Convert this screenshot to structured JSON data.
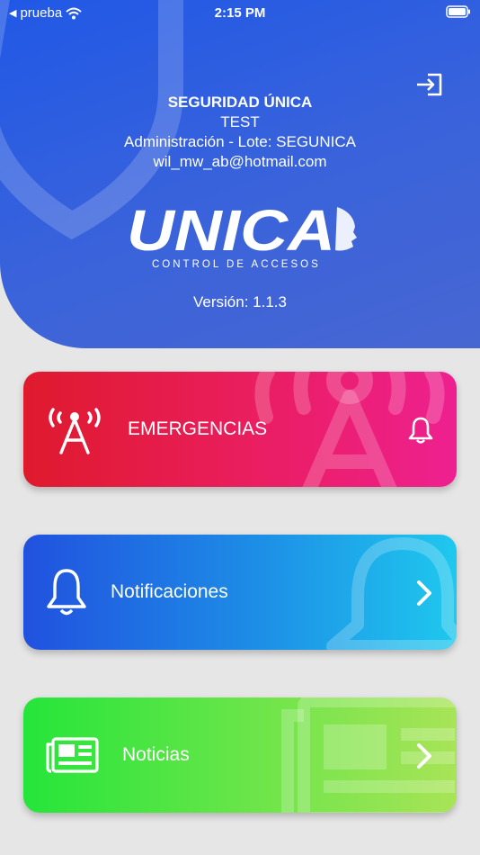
{
  "status_bar": {
    "carrier": "prueba",
    "time": "2:15 PM"
  },
  "header": {
    "company": "SEGURIDAD ÚNICA",
    "account": "TEST",
    "location": "Administración - Lote: SEGUNICA",
    "email": "wil_mw_ab@hotmail.com",
    "logo_word": "UNICA",
    "logo_tagline": "CONTROL DE ACCESOS",
    "version": "Versión: 1.1.3",
    "logout_icon": "logout-icon"
  },
  "menu": {
    "emergencias": {
      "label": "EMERGENCIAS",
      "icon": "antenna-icon",
      "trail_icon": "bell-icon",
      "color": "#e81e52"
    },
    "notificaciones": {
      "label": "Notificaciones",
      "icon": "bell-icon",
      "trail_icon": "chevron-right-icon",
      "color": "#1d8fe6"
    },
    "noticias": {
      "label": "Noticias",
      "icon": "newspaper-icon",
      "trail_icon": "chevron-right-icon",
      "color": "#6ee54a"
    }
  }
}
